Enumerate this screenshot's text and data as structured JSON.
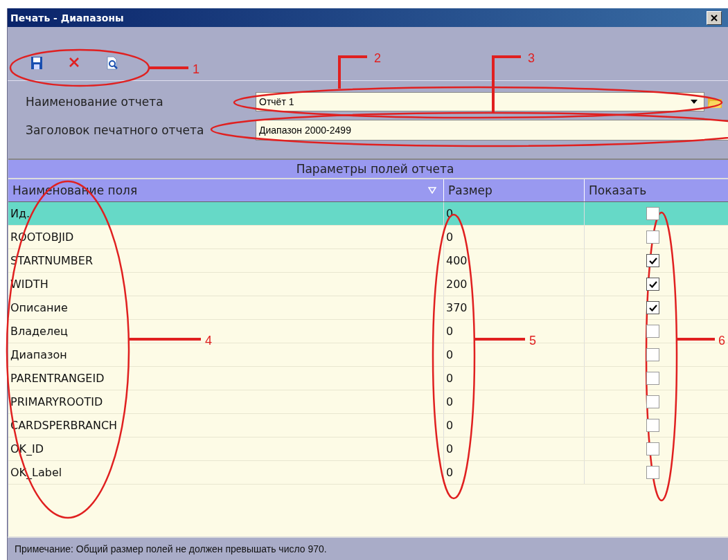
{
  "window": {
    "title": "Печать - Диапазоны"
  },
  "toolbar": [
    {
      "kind": "save"
    },
    {
      "kind": "delete"
    },
    {
      "kind": "preview"
    }
  ],
  "form": {
    "report_name": {
      "label": "Наименование отчета",
      "value": "Отчёт 1"
    },
    "report_title": {
      "label": "Заголовок печатного отчета",
      "value": "Диапазон 2000-2499"
    }
  },
  "table": {
    "caption": "Параметры полей отчета",
    "columns": [
      "Наименование поля",
      "Размер",
      "Показать"
    ],
    "rows": [
      {
        "name": "Ид.",
        "size": "0",
        "show": false,
        "selected": true
      },
      {
        "name": "ROOTOBJID",
        "size": "0",
        "show": false,
        "selected": false
      },
      {
        "name": "STARTNUMBER",
        "size": "400",
        "show": true,
        "selected": false
      },
      {
        "name": "WIDTH",
        "size": "200",
        "show": true,
        "selected": false
      },
      {
        "name": "Описание",
        "size": "370",
        "show": true,
        "selected": false
      },
      {
        "name": "Владелец",
        "size": "0",
        "show": false,
        "selected": false
      },
      {
        "name": "Диапазон",
        "size": "0",
        "show": false,
        "selected": false
      },
      {
        "name": "PARENTRANGEID",
        "size": "0",
        "show": false,
        "selected": false
      },
      {
        "name": "PRIMARYROOTID",
        "size": "0",
        "show": false,
        "selected": false
      },
      {
        "name": "CARDSPERBRANCH",
        "size": "0",
        "show": false,
        "selected": false
      },
      {
        "name": "OK_ID",
        "size": "0",
        "show": false,
        "selected": false
      },
      {
        "name": "OK_Label",
        "size": "0",
        "show": false,
        "selected": false
      }
    ]
  },
  "status_bar": "Примечание: Общий размер полей не должен превышать число 970.",
  "annotations": [
    {
      "label": "1"
    },
    {
      "label": "2"
    },
    {
      "label": "3"
    },
    {
      "label": "4"
    },
    {
      "label": "5"
    },
    {
      "label": "6"
    }
  ]
}
